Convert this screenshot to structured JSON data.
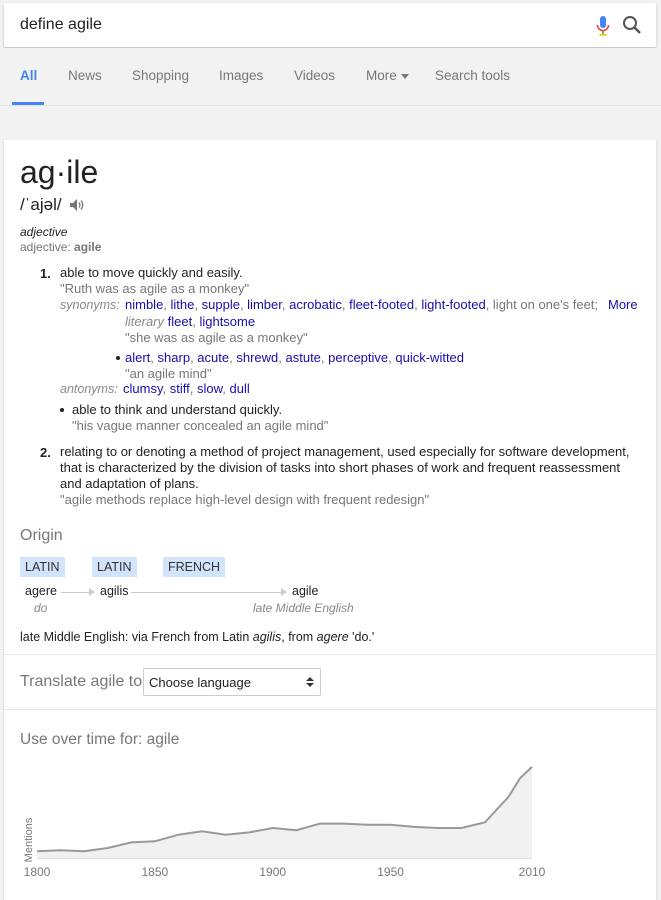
{
  "search": {
    "query": "define agile"
  },
  "tabs": [
    {
      "label": "All",
      "active": true
    },
    {
      "label": "News"
    },
    {
      "label": "Shopping"
    },
    {
      "label": "Images"
    },
    {
      "label": "Videos"
    },
    {
      "label": "More"
    },
    {
      "label": "Search tools"
    }
  ],
  "entry": {
    "word": "ag·ile",
    "phonetic": "/ˈajəl/",
    "pos": "adjective",
    "pos_line_prefix": "adjective: ",
    "pos_line_word": "agile"
  },
  "sense1": {
    "num": "1.",
    "def": "able to move quickly and easily.",
    "example": "\"Ruth was as agile as a monkey\"",
    "syn_label": "synonyms:",
    "synonyms": [
      "nimble",
      "lithe",
      "supple",
      "limber",
      "acrobatic",
      "fleet-footed",
      "light-footed"
    ],
    "syn_plain": "light on one's feet;",
    "syn_more": "More",
    "literary_label": "literary",
    "literary_syns": [
      "fleet",
      "lightsome"
    ],
    "syn_example": "\"she was as agile as a monkey\"",
    "sub_synonyms": [
      "alert",
      "sharp",
      "acute",
      "shrewd",
      "astute",
      "perceptive",
      "quick-witted"
    ],
    "sub_example": "\"an agile mind\"",
    "ant_label": "antonyms:",
    "antonyms": [
      "clumsy",
      "stiff",
      "slow",
      "dull"
    ],
    "sub_def": "able to think and understand quickly.",
    "sub_def_example": "\"his vague manner concealed an agile mind\""
  },
  "sense2": {
    "num": "2.",
    "def_lines": [
      "relating to or denoting a method of project management, used especially for software development,",
      "that is characterized by the division of tasks into short phases of work and frequent reassessment",
      "and adaptation of plans."
    ],
    "example": "\"agile methods replace high-level design with frequent redesign\""
  },
  "origin": {
    "title": "Origin",
    "languages": [
      "LATIN",
      "LATIN",
      "FRENCH"
    ],
    "words": [
      "agere",
      "agilis",
      "agile"
    ],
    "glosses": [
      "do",
      "late Middle English"
    ],
    "text_prefix": "late Middle English: via French from Latin ",
    "text_agilis": "agilis",
    "text_mid": ", from ",
    "text_agere": "agere",
    "text_suffix": " 'do.'"
  },
  "translate": {
    "label": "Translate agile to",
    "selected": "Choose language"
  },
  "chart_data": {
    "type": "area",
    "title": "Use over time for: agile",
    "ylabel": "Mentions",
    "xlabel": "",
    "x_ticks": [
      "1800",
      "1850",
      "1900",
      "1950",
      "2010"
    ],
    "x": [
      1800,
      1810,
      1820,
      1830,
      1840,
      1850,
      1860,
      1870,
      1880,
      1890,
      1900,
      1910,
      1920,
      1930,
      1940,
      1950,
      1960,
      1970,
      1980,
      1990,
      2000,
      2005,
      2010
    ],
    "values": [
      6,
      7,
      6,
      9,
      14,
      15,
      21,
      24,
      21,
      23,
      27,
      25,
      31,
      31,
      30,
      30,
      28,
      27,
      27,
      32,
      55,
      72,
      82
    ],
    "ylim": [
      0,
      90
    ],
    "color": "#999999",
    "fill": "#f1f1f1"
  }
}
